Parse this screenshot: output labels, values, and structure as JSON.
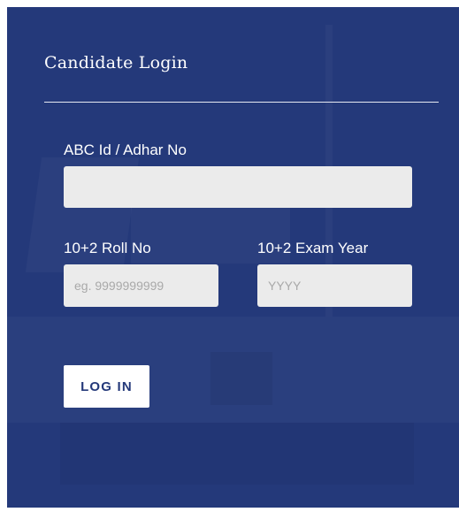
{
  "form": {
    "title": "Candidate Login",
    "abc_id": {
      "label": "ABC Id / Adhar No",
      "value": "",
      "placeholder": ""
    },
    "roll_no": {
      "label": "10+2 Roll No",
      "value": "",
      "placeholder": "eg. 9999999999"
    },
    "exam_year": {
      "label": "10+2 Exam Year",
      "value": "",
      "placeholder": "YYYY"
    },
    "login_label": "LOG IN"
  },
  "colors": {
    "panel_background": "#24397a",
    "field_background": "#ebebeb",
    "button_background": "#ffffff",
    "button_text": "#24397a"
  }
}
